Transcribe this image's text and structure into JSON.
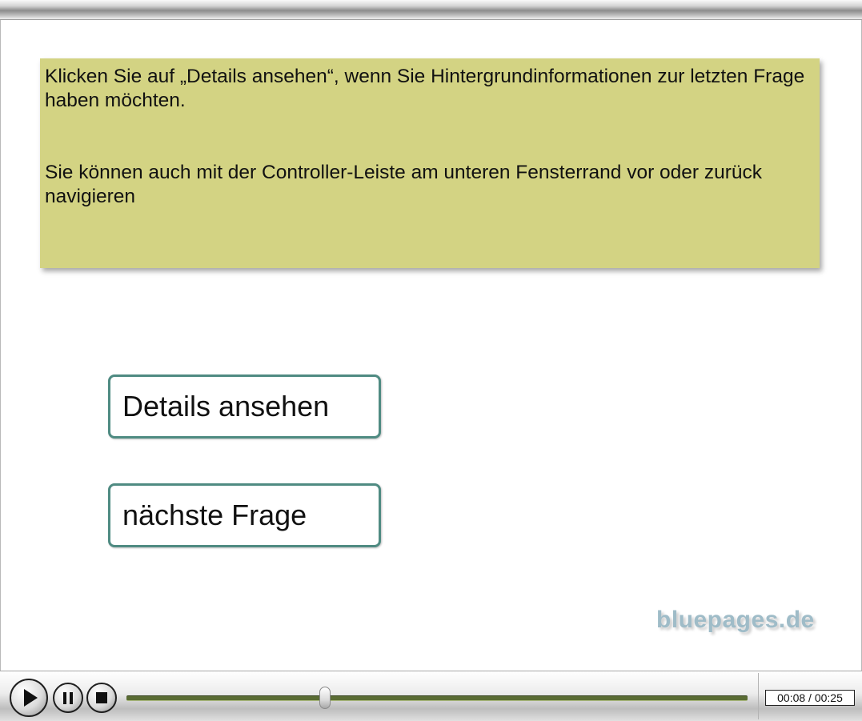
{
  "note": {
    "paragraph1": "Klicken Sie auf „Details ansehen“, wenn Sie Hintergrundinformationen zur letzten Frage haben möchten.",
    "paragraph2": "Sie können auch mit der Controller-Leiste am unteren Fensterrand vor oder zurück navigieren",
    "background_color": "#d3d383"
  },
  "buttons": {
    "details_label": "Details ansehen",
    "next_label": "nächste Frage",
    "border_color": "#4f8b82"
  },
  "watermark": "bluepages.de",
  "controller": {
    "play_icon": "play-icon",
    "pause_icon": "pause-icon",
    "stop_icon": "stop-icon",
    "elapsed": "00:08",
    "total": "00:25",
    "time_display": "00:08 / 00:25",
    "progress_fraction": 0.32
  }
}
